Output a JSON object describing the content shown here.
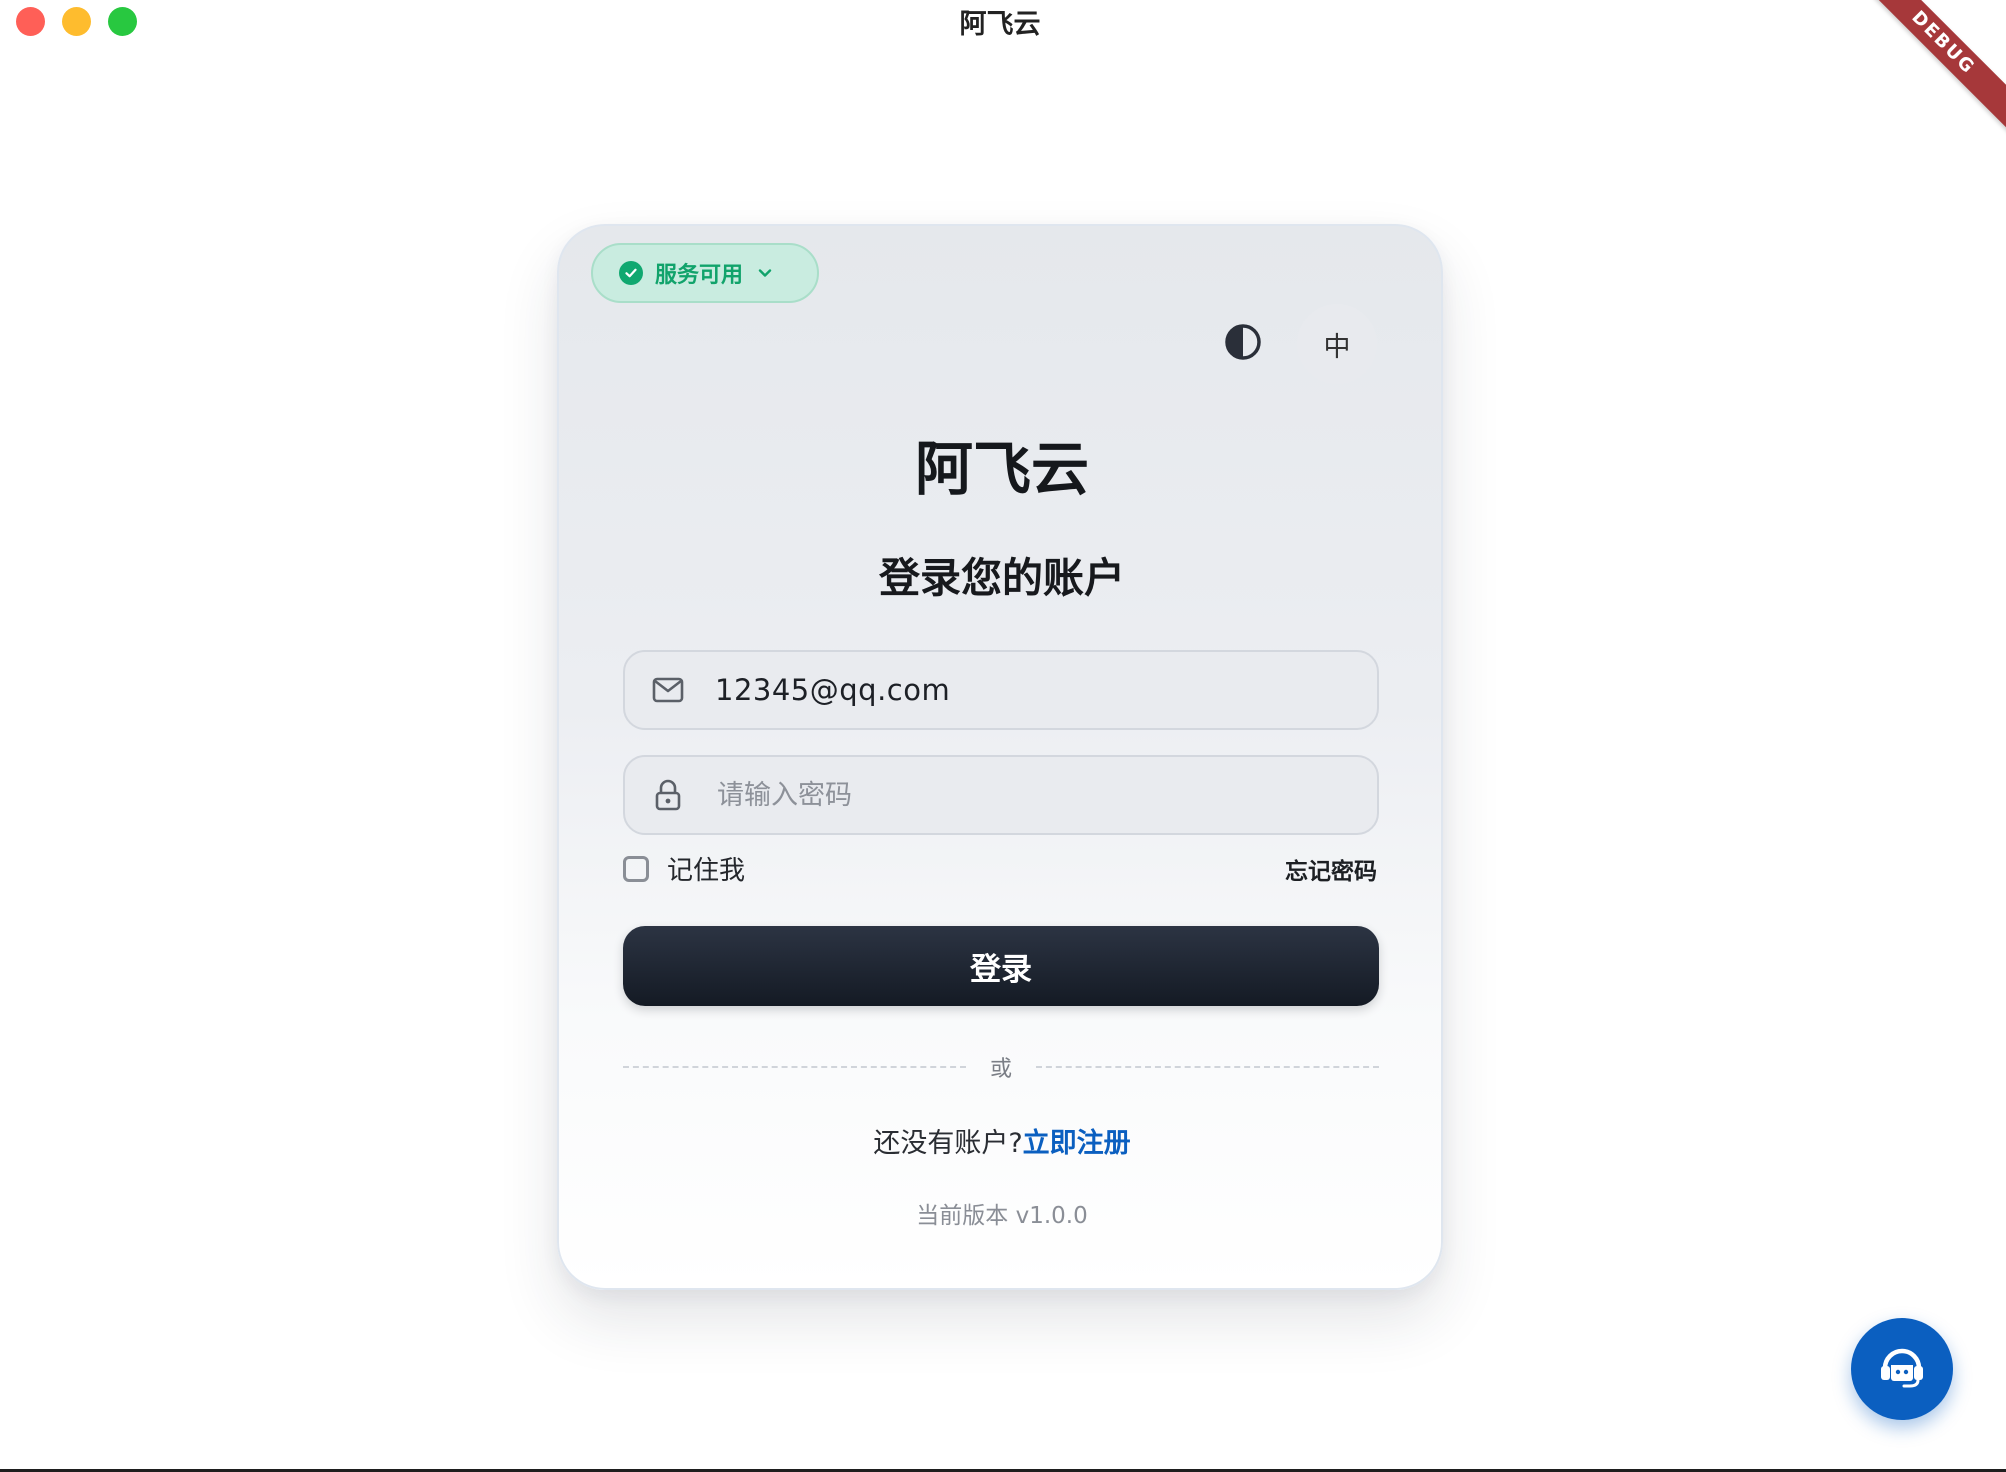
{
  "window": {
    "title": "阿飞云",
    "debug_banner": "DEBUG"
  },
  "status": {
    "label": "服务可用",
    "color": "#11a36b"
  },
  "toolbar": {
    "theme_icon": "contrast-icon",
    "language_label": "中"
  },
  "brand": {
    "title": "阿飞云",
    "subtitle": "登录您的账户"
  },
  "form": {
    "email_value": "12345@qq.com",
    "password_placeholder": "请输入密码",
    "remember_label": "记住我",
    "remember_checked": false,
    "forgot_label": "忘记密码",
    "login_label": "登录",
    "divider_label": "或"
  },
  "signup": {
    "prompt": "还没有账户?",
    "link_label": "立即注册"
  },
  "footer": {
    "version": "当前版本 v1.0.0"
  },
  "colors": {
    "accent": "#0b5fc0",
    "button_dark": "#141a24"
  },
  "icons": {
    "fab": "headset-support-icon"
  }
}
